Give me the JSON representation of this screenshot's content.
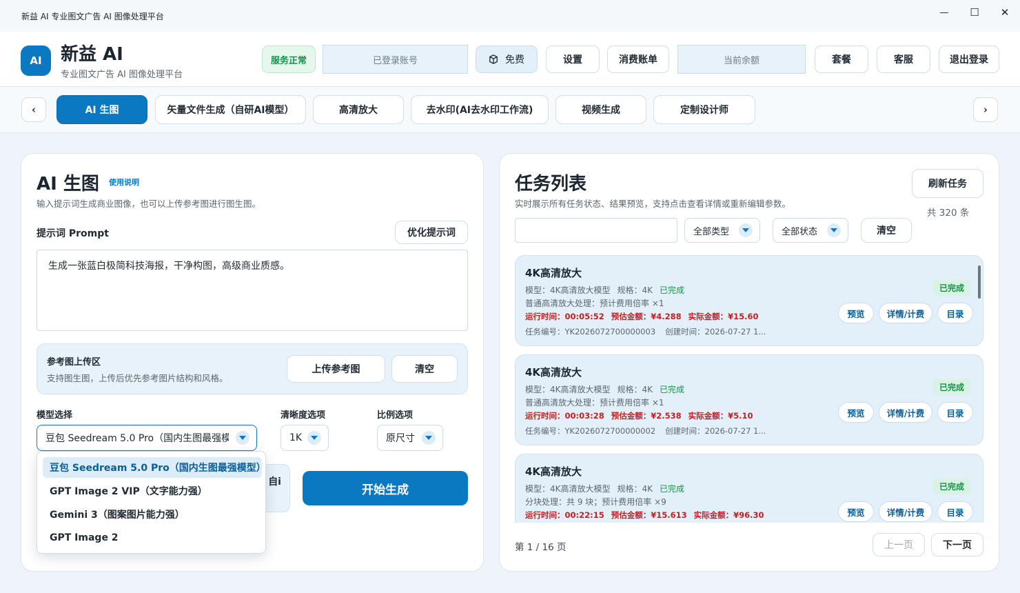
{
  "window": {
    "title": "新益 AI  专业图文广告 AI 图像处理平台",
    "minimize": "—",
    "maximize": "☐",
    "close": "✕"
  },
  "header": {
    "logo": "AI",
    "app_name": "新益 AI",
    "app_subtitle": "专业图文广告 AI 图像处理平台",
    "service_status": "服务正常",
    "account_placeholder": "已登录账号",
    "plan_label": "免费",
    "settings": "设置",
    "billing": "消费账单",
    "balance_placeholder": "当前余额",
    "packages": "套餐",
    "support": "客服",
    "logout": "退出登录"
  },
  "tabs": {
    "prev": "‹",
    "next": "›",
    "items": [
      "AI 生图",
      "矢量文件生成（自研AI模型）",
      "高清放大",
      "去水印(AI去水印工作流)",
      "视频生成",
      "定制设计师"
    ]
  },
  "left": {
    "title": "AI 生图",
    "help_link": "使用说明",
    "subtitle": "输入提示词生成商业图像，也可以上传参考图进行图生图。",
    "prompt_label": "提示词 Prompt",
    "optimize_btn": "优化提示词",
    "prompt_value": "生成一张蓝白极简科技海报，干净构图，高级商业质感。",
    "upload_title": "参考图上传区",
    "upload_desc": "支持图生图，上传后优先参考图片结构和风格。",
    "upload_btn": "上传参考图",
    "clear_btn": "清空",
    "model_label": "模型选择",
    "model_value": "豆包 Seedream 5.0 Pro（国内生图最强模型）",
    "clarity_label": "清晰度选项",
    "clarity_value": "1K",
    "ratio_label": "比例选项",
    "ratio_value": "原尺寸",
    "hidden_text": "自i",
    "generate_btn": "开始生成",
    "model_options": [
      "豆包 Seedream 5.0 Pro（国内生图最强模型）",
      "GPT Image 2 VIP（文字能力强）",
      "Gemini 3（图案图片能力强）",
      "GPT Image 2"
    ]
  },
  "right": {
    "title": "任务列表",
    "subtitle": "实时展示所有任务状态、结果预览，支持点击查看详情或重新编辑参数。",
    "refresh_btn": "刷新任务",
    "total": "共 320 条",
    "type_filter": "全部类型",
    "status_filter": "全部状态",
    "clear_btn": "清空",
    "pagination": {
      "info": "第 1 / 16 页",
      "prev": "上一页",
      "next": "下一页"
    },
    "tasks": [
      {
        "title": "4K高清放大",
        "model": "模型：4K高清放大模型",
        "spec": "规格：4K",
        "status": "已完成",
        "desc": "普通高清放大处理：预计费用倍率 ×1",
        "runtime": "运行时间：00:05:52",
        "estimate": "预估金额：¥4.288",
        "actual": "实际金额：¥15.60",
        "task_id": "任务编号：YK2026072700000003",
        "created": "创建时间：2026-07-27 1...",
        "badge": "已完成",
        "preview": "预览",
        "detail": "详情/计费",
        "folder": "目录"
      },
      {
        "title": "4K高清放大",
        "model": "模型：4K高清放大模型",
        "spec": "规格：4K",
        "status": "已完成",
        "desc": "普通高清放大处理：预计费用倍率 ×1",
        "runtime": "运行时间：00:03:28",
        "estimate": "预估金额：¥2.538",
        "actual": "实际金额：¥5.10",
        "task_id": "任务编号：YK2026072700000002",
        "created": "创建时间：2026-07-27 1...",
        "badge": "已完成",
        "preview": "预览",
        "detail": "详情/计费",
        "folder": "目录"
      },
      {
        "title": "4K高清放大",
        "model": "模型：4K高清放大模型",
        "spec": "规格：4K",
        "status": "已完成",
        "desc": "分块处理：共 9 块；预计费用倍率 ×9",
        "runtime": "运行时间：00:22:15",
        "estimate": "预估金额：¥15.613",
        "actual": "实际金额：¥96.30",
        "task_id": "",
        "created": "",
        "badge": "已完成",
        "preview": "预览",
        "detail": "详情/计费",
        "folder": "目录"
      }
    ]
  },
  "colors": {
    "accent": "#0b78c2",
    "success": "#16924a",
    "danger": "#c61f1f",
    "card_bg": "#e3f0fa"
  }
}
